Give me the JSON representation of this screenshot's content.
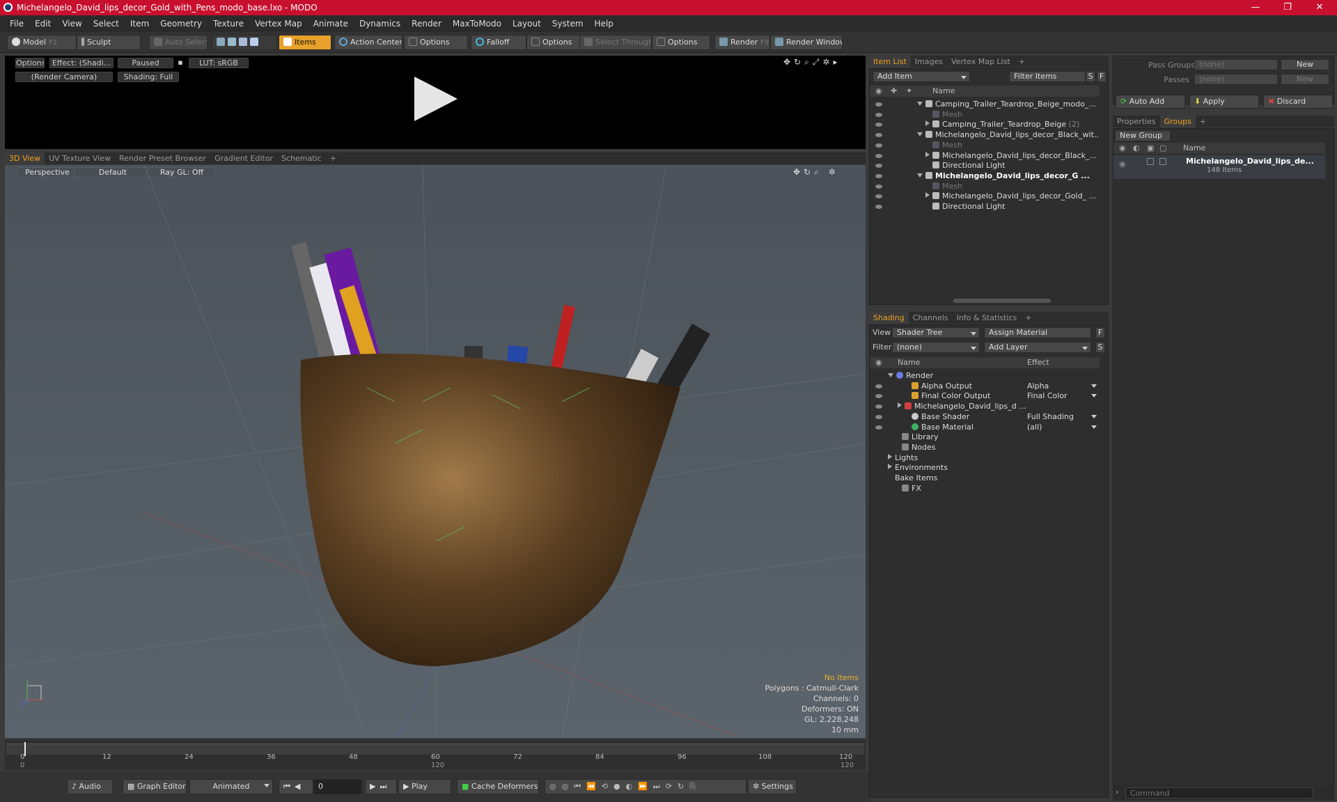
{
  "window": {
    "title": "Michelangelo_David_lips_decor_Gold_with_Pens_modo_base.lxo - MODO",
    "minimize": "—",
    "maximize": "❐",
    "close": "✕"
  },
  "menu": [
    "File",
    "Edit",
    "View",
    "Select",
    "Item",
    "Geometry",
    "Texture",
    "Vertex Map",
    "Animate",
    "Dynamics",
    "Render",
    "MaxToModo",
    "Layout",
    "System",
    "Help"
  ],
  "toolbar": {
    "model": "Model",
    "model_key": "F2",
    "sculpt": "Sculpt",
    "auto_select": "Auto Select",
    "items": "Items",
    "action_center": "Action Center",
    "options1": "Options",
    "falloff": "Falloff",
    "options2": "Options",
    "select_through": "Select Through",
    "options3": "Options",
    "render": "Render",
    "render_key": "F9",
    "render_window": "Render Window"
  },
  "preview": {
    "options": "Options",
    "effect": "Effect: (Shadi...",
    "paused": "Paused",
    "lut": "LUT: sRGB",
    "camera": "(Render Camera)",
    "shading": "Shading: Full"
  },
  "viewtabs": [
    "3D View",
    "UV Texture View",
    "Render Preset Browser",
    "Gradient Editor",
    "Schematic",
    "+"
  ],
  "viewport": {
    "perspective": "Perspective",
    "default": "Default",
    "raygl": "Ray GL: Off",
    "stats": {
      "no_items": "No Items",
      "polygons": "Polygons : Catmull-Clark",
      "channels": "Channels: 0",
      "deformers": "Deformers: ON",
      "gl": "GL: 2,228,248",
      "size": "10 mm"
    }
  },
  "timeline": {
    "ticks": [
      "0",
      "12",
      "24",
      "36",
      "48",
      "60",
      "72",
      "84",
      "96",
      "108",
      "120"
    ],
    "start": "0",
    "mid": "120",
    "end": "120"
  },
  "bottombar": {
    "audio": "Audio",
    "graph_editor": "Graph Editor",
    "animated": "Animated",
    "frame": "0",
    "play": "Play",
    "cache_deformers": "Cache Deformers",
    "settings": "Settings"
  },
  "itemlist": {
    "tabs": [
      "Item List",
      "Images",
      "Vertex Map List",
      "+"
    ],
    "add_item": "Add Item",
    "filter_items": "Filter Items",
    "s": "S",
    "f": "F",
    "col_name": "Name",
    "rows": [
      {
        "label": "Camping_Trailer_Teardrop_Beige_modo_...",
        "indent": 1,
        "style": "normal",
        "tri": "down"
      },
      {
        "label": "Mesh",
        "indent": 2,
        "style": "dim",
        "tri": ""
      },
      {
        "label": "Camping_Trailer_Teardrop_Beige",
        "suffix": "(2)",
        "indent": 2,
        "style": "normal",
        "tri": "right"
      },
      {
        "label": "Michelangelo_David_lips_decor_Black_wit...",
        "indent": 1,
        "style": "normal",
        "tri": "down"
      },
      {
        "label": "Mesh",
        "indent": 2,
        "style": "dim",
        "tri": ""
      },
      {
        "label": "Michelangelo_David_lips_decor_Black_...",
        "indent": 2,
        "style": "normal",
        "tri": "right"
      },
      {
        "label": "Directional Light",
        "indent": 2,
        "style": "normal",
        "tri": ""
      },
      {
        "label": "Michelangelo_David_lips_decor_G ...",
        "indent": 1,
        "style": "bold",
        "tri": "down"
      },
      {
        "label": "Mesh",
        "indent": 2,
        "style": "dim",
        "tri": ""
      },
      {
        "label": "Michelangelo_David_lips_decor_Gold_ ...",
        "indent": 2,
        "style": "normal",
        "tri": "right"
      },
      {
        "label": "Directional Light",
        "indent": 2,
        "style": "normal",
        "tri": ""
      }
    ]
  },
  "shading": {
    "tabs": [
      "Shading",
      "Channels",
      "Info & Statistics",
      "+"
    ],
    "view_label": "View",
    "view_value": "Shader Tree",
    "assign_material": "Assign Material",
    "f": "F",
    "filter_label": "Filter",
    "filter_value": "(none)",
    "add_layer": "Add Layer",
    "s": "S",
    "col_name": "Name",
    "col_effect": "Effect",
    "rows": [
      {
        "label": "Render",
        "effect": "",
        "indent": 1,
        "tri": "down",
        "icon": "#6a7de0",
        "eye": false
      },
      {
        "label": "Alpha Output",
        "effect": "Alpha",
        "indent": 2,
        "tri": "",
        "icon": "#d9a030",
        "eye": true
      },
      {
        "label": "Final Color Output",
        "effect": "Final Color",
        "indent": 2,
        "tri": "",
        "icon": "#d9a030",
        "eye": true
      },
      {
        "label": "Michelangelo_David_lips_d ...",
        "effect": "",
        "indent": 2,
        "tri": "right",
        "icon": "#d04040",
        "eye": true
      },
      {
        "label": "Base Shader",
        "effect": "Full Shading",
        "indent": 2,
        "tri": "",
        "icon": "#cccccc",
        "eye": true
      },
      {
        "label": "Base Material",
        "effect": "(all)",
        "indent": 2,
        "tri": "",
        "icon": "#40b060",
        "eye": true
      },
      {
        "label": "Library",
        "effect": "",
        "indent": 1,
        "tri": "",
        "icon": "#888888",
        "eye": false
      },
      {
        "label": "Nodes",
        "effect": "",
        "indent": 1,
        "tri": "",
        "icon": "#888888",
        "eye": false
      },
      {
        "label": "Lights",
        "effect": "",
        "indent": 0,
        "tri": "right",
        "icon": "",
        "eye": false
      },
      {
        "label": "Environments",
        "effect": "",
        "indent": 0,
        "tri": "right",
        "icon": "",
        "eye": false
      },
      {
        "label": "Bake Items",
        "effect": "",
        "indent": 0,
        "tri": "",
        "icon": "",
        "eye": false
      },
      {
        "label": "FX",
        "effect": "",
        "indent": 1,
        "tri": "",
        "icon": "#888888",
        "eye": false
      }
    ]
  },
  "right": {
    "pass_groups_label": "Pass Groups",
    "pass_groups_value": "(none)",
    "new": "New",
    "passes_label": "Passes",
    "passes_value": "(none)",
    "new2": "New",
    "auto_add": "Auto Add",
    "apply": "Apply",
    "discard": "Discard",
    "tabs": [
      "Properties",
      "Groups",
      "+"
    ],
    "new_group": "New Group",
    "col_name": "Name",
    "group_name": "Michelangelo_David_lips_de...",
    "group_count": "148 Items",
    "command_placeholder": "Command"
  },
  "colors": {
    "accent": "#f0a020",
    "titlebar": "#c8102e"
  }
}
